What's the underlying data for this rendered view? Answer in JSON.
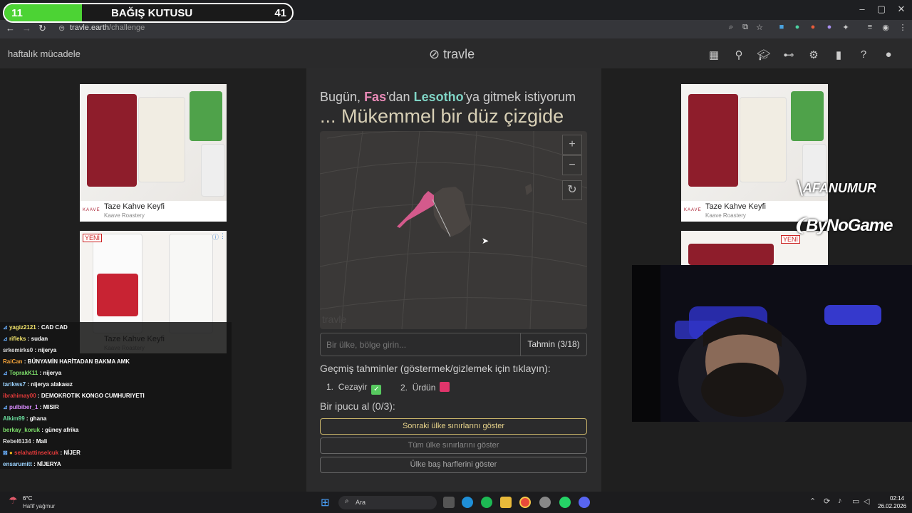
{
  "donation": {
    "left_value": "11",
    "title": "BAĞIŞ KUTUSU",
    "right_value": "41",
    "fill_fraction": 0.27,
    "color": "#4cd334"
  },
  "browser": {
    "url_host": "travle.earth",
    "url_path": "/challenge"
  },
  "header": {
    "left_label": "haftalık mücadele",
    "logo": "travle"
  },
  "headline": {
    "part1": "Bugün, ",
    "origin": "Fas",
    "part2": "'dan ",
    "destination": "Lesotho",
    "part3": "'ya gitmek istiyorum",
    "line2": "... Mükemmel bir düz çizgide",
    "origin_color": "#e98ab7",
    "destination_color": "#7fd4c5"
  },
  "map": {
    "zoom_in": "+",
    "zoom_out": "−",
    "reset": "↻",
    "watermark": "travle"
  },
  "guess": {
    "placeholder": "Bir ülke, bölge girin...",
    "button": "Tahmin (3/18)"
  },
  "past": {
    "title": "Geçmiş tahminler (göstermek/gizlemek için tıklayın):",
    "items": [
      {
        "index": "1.",
        "name": "Cezayir",
        "status": "correct",
        "color": "#57c95f"
      },
      {
        "index": "2.",
        "name": "Ürdün",
        "status": "wrong",
        "color": "#e0356b"
      }
    ]
  },
  "hints": {
    "title": "Bir ipucu al (0/3):",
    "buttons": [
      "Sonraki ülke sınırlarını göster",
      "Tüm ülke sınırlarını göster",
      "Ülke baş harflerini göster"
    ]
  },
  "ads": {
    "title": "Taze Kahve Keyfi",
    "sub": "Kaave Roastery",
    "brand": "KAAVE",
    "new_badge": "YENİ"
  },
  "chat": [
    {
      "user": "yagiz2121",
      "msg": "CAD CAD",
      "color": "#f2e46b"
    },
    {
      "user": "rifleks",
      "msg": "sudan",
      "color": "#f2e46b"
    },
    {
      "user": "srkemirks0",
      "msg": "nijerya",
      "color": "#dddddd"
    },
    {
      "user": "RaiCan",
      "msg": "BÜNYAMİN HARİTADAN BAKMA AMK",
      "color": "#f2a23a"
    },
    {
      "user": "ToprakK11",
      "msg": "nijerya",
      "color": "#7ee06b"
    },
    {
      "user": "tarikws7",
      "msg": "nijerya alakasız",
      "color": "#9bd3ff"
    },
    {
      "user": "ibrahimay00",
      "msg": "DEMOKROTIK KONGO CUMHURIYETI",
      "color": "#e23a3a"
    },
    {
      "user": "pulbiber_1",
      "msg": "MISIR",
      "color": "#d98cff"
    },
    {
      "user": "Alkim99",
      "msg": "ghana",
      "color": "#6be0a0"
    },
    {
      "user": "berkay_koruk",
      "msg": "güney afrika",
      "color": "#7ee06b"
    },
    {
      "user": "Rebel6134",
      "msg": "Mali",
      "color": "#dddddd"
    },
    {
      "user": "selahattinselcuk",
      "msg": "NİJER",
      "color": "#e23a3a"
    },
    {
      "user": "ensarumitt",
      "msg": "NİJERYA",
      "color": "#9bd3ff"
    }
  ],
  "overlays": {
    "name1": "AFANUMUR",
    "name2": "ByNoGame"
  },
  "taskbar": {
    "temp": "6°C",
    "weather": "Hafif yağmur",
    "search": "Ara",
    "time": "02:14",
    "date": "26.02.2026"
  }
}
